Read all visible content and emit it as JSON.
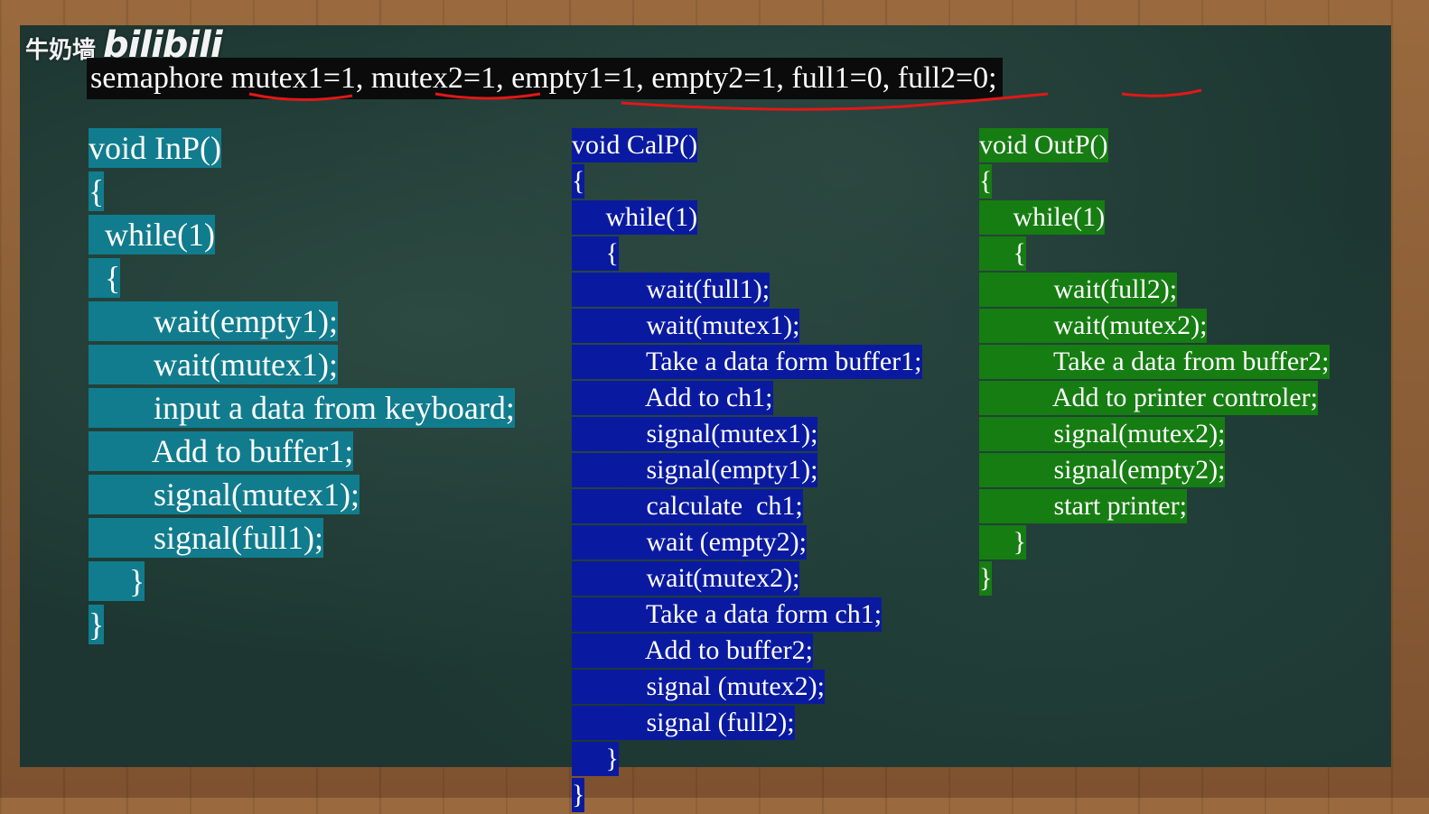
{
  "watermark": {
    "channel": "牛奶墙",
    "logo": "bilibili"
  },
  "semaphore_line": "semaphore mutex1=1, mutex2=1, empty1=1, empty2=1, full1=0, full2=0;",
  "colors": {
    "inp_bg": "#117c8d",
    "calp_bg": "#0a1aa0",
    "outp_bg": "#167d12",
    "underline": "#e01818"
  },
  "inp": [
    "void InP()",
    "{",
    "  while(1)",
    "  {",
    "        wait(empty1);",
    "        wait(mutex1);",
    "        input a data from keyboard;",
    "        Add to buffer1;",
    "        signal(mutex1);",
    "        signal(full1);",
    "     }",
    "}"
  ],
  "calp": [
    "void CalP()",
    "{",
    "     while(1)",
    "     {",
    "           wait(full1);",
    "           wait(mutex1);",
    "           Take a data form buffer1;",
    "           Add to ch1;",
    "           signal(mutex1);",
    "           signal(empty1);",
    "           calculate  ch1;",
    "           wait (empty2);",
    "           wait(mutex2);",
    "           Take a data form ch1;",
    "           Add to buffer2;",
    "           signal (mutex2);",
    "           signal (full2);",
    "     }",
    "}"
  ],
  "outp": [
    "void OutP()",
    "{",
    "     while(1)",
    "     {",
    "           wait(full2);",
    "           wait(mutex2);",
    "           Take a data from buffer2;",
    "           Add to printer controler;",
    "           signal(mutex2);",
    "           signal(empty2);",
    "           start printer;",
    "     }",
    "}"
  ]
}
